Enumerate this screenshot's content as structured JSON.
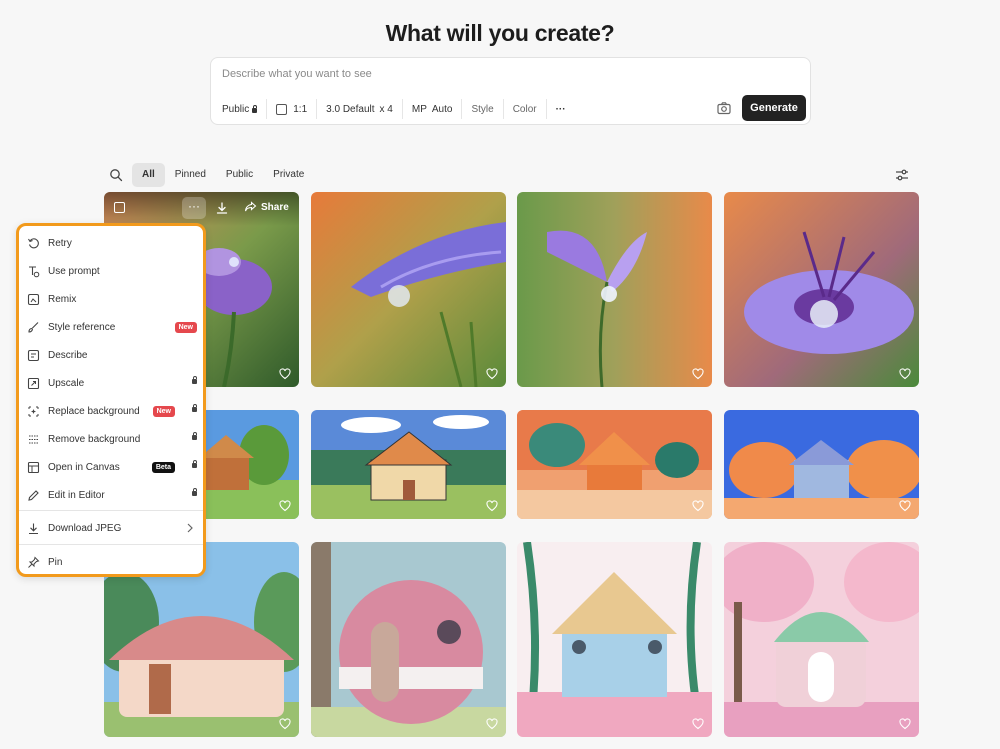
{
  "header": {
    "title": "What will you create?"
  },
  "prompt": {
    "placeholder": "Describe what you want to see",
    "options": {
      "visibility": "Public",
      "aspect_ratio": "1:1",
      "model": "3.0 Default",
      "count": "x 4",
      "mp_label": "MP",
      "mp_value": "Auto",
      "style": "Style",
      "color": "Color",
      "more": "···"
    },
    "generate_label": "Generate"
  },
  "filters": {
    "tabs": [
      {
        "label": "All",
        "active": true
      },
      {
        "label": "Pinned",
        "active": false
      },
      {
        "label": "Public",
        "active": false
      },
      {
        "label": "Private",
        "active": false
      }
    ]
  },
  "tile_overlay": {
    "more": "···",
    "share": "Share"
  },
  "context_menu": {
    "items": [
      {
        "label": "Retry",
        "icon": "retry-icon"
      },
      {
        "label": "Use prompt",
        "icon": "use-prompt-icon"
      },
      {
        "label": "Remix",
        "icon": "remix-icon"
      },
      {
        "label": "Style reference",
        "icon": "brush-icon",
        "badge": "New"
      },
      {
        "label": "Describe",
        "icon": "describe-icon"
      },
      {
        "label": "Upscale",
        "icon": "upscale-icon",
        "locked": true
      },
      {
        "label": "Replace background",
        "icon": "replace-background-icon",
        "badge": "New",
        "locked": true
      },
      {
        "label": "Remove background",
        "icon": "remove-background-icon",
        "locked": true
      },
      {
        "label": "Open in Canvas",
        "icon": "canvas-icon",
        "badge": "Beta",
        "locked": true
      },
      {
        "label": "Edit in Editor",
        "icon": "pencil-icon",
        "locked": true
      },
      {
        "label": "Download JPEG",
        "icon": "download-icon"
      },
      {
        "label": "Pin",
        "icon": "pin-icon"
      }
    ]
  },
  "colors": {
    "accent_outline": "#f29a1c",
    "button_dark": "#222222",
    "badge_new": "#e5484d",
    "badge_beta": "#111111"
  }
}
